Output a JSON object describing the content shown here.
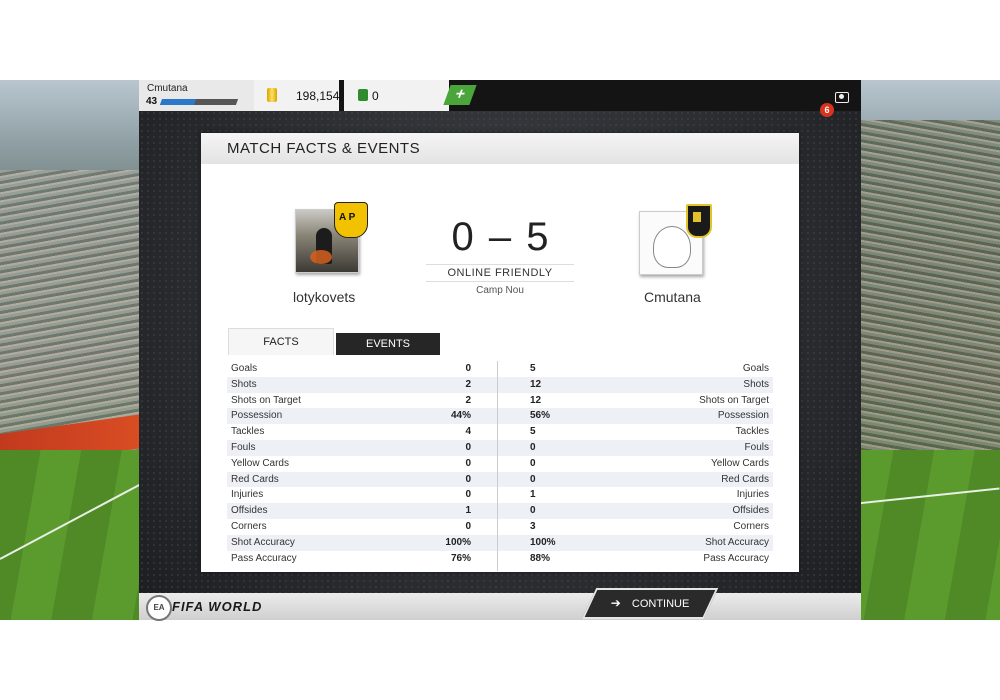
{
  "topbar": {
    "username": "Cmutana",
    "level": "43",
    "xp_fraction": 0.45,
    "coins": "198,154",
    "points": "0",
    "plus_label": "+",
    "notification_count": "6"
  },
  "card": {
    "title": "MATCH FACTS & EVENTS",
    "home_team": "lotykovets",
    "away_team": "Cmutana",
    "score": "0 – 5",
    "match_type": "ONLINE FRIENDLY",
    "venue": "Camp Nou",
    "tabs": [
      {
        "label": "FACTS",
        "active": true
      },
      {
        "label": "EVENTS",
        "active": false
      }
    ],
    "stats": [
      {
        "label": "Goals",
        "home": "0",
        "away": "5"
      },
      {
        "label": "Shots",
        "home": "2",
        "away": "12"
      },
      {
        "label": "Shots on Target",
        "home": "2",
        "away": "12"
      },
      {
        "label": "Possession",
        "home": "44%",
        "away": "56%"
      },
      {
        "label": "Tackles",
        "home": "4",
        "away": "5"
      },
      {
        "label": "Fouls",
        "home": "0",
        "away": "0"
      },
      {
        "label": "Yellow Cards",
        "home": "0",
        "away": "0"
      },
      {
        "label": "Red Cards",
        "home": "0",
        "away": "0"
      },
      {
        "label": "Injuries",
        "home": "0",
        "away": "1"
      },
      {
        "label": "Offsides",
        "home": "1",
        "away": "0"
      },
      {
        "label": "Corners",
        "home": "0",
        "away": "3"
      },
      {
        "label": "Shot Accuracy",
        "home": "100%",
        "away": "100%"
      },
      {
        "label": "Pass Accuracy",
        "home": "76%",
        "away": "88%"
      }
    ]
  },
  "bottombar": {
    "ea_logo": "EA SPORTS",
    "brand": "FIFA WORLD",
    "continue_label": "CONTINUE"
  },
  "colors": {
    "accent_green": "#4aa53a",
    "xp_blue": "#2a78c7",
    "badge_red": "#d9331f",
    "dark_button": "#2a2a2a"
  }
}
